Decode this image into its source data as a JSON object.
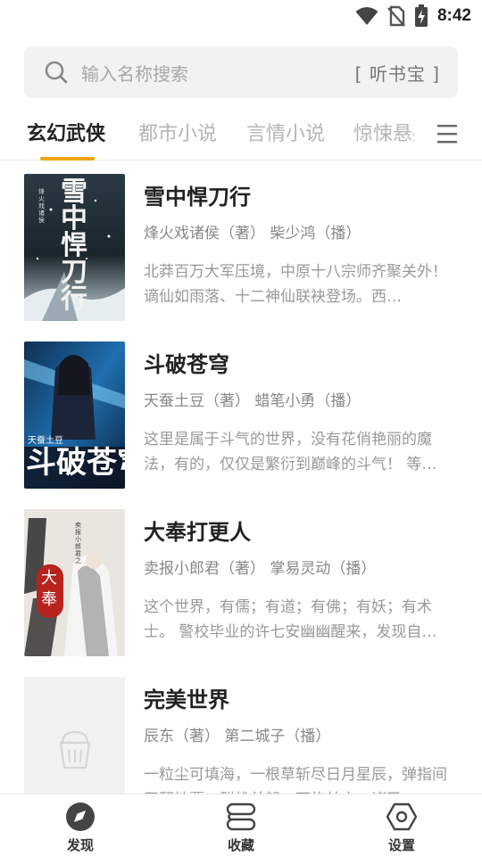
{
  "status_bar": {
    "time": "8:42",
    "icons": [
      "wifi-icon",
      "no-sim-icon",
      "battery-charging-icon"
    ]
  },
  "search": {
    "placeholder": "输入名称搜索",
    "source": "[ 听书宝 ]"
  },
  "tabs": [
    {
      "label": "玄幻武侠",
      "active": true
    },
    {
      "label": "都市小说",
      "active": false
    },
    {
      "label": "言情小说",
      "active": false
    },
    {
      "label": "惊悚悬疑",
      "active": false
    }
  ],
  "colors": {
    "accent": "#f0a500",
    "title": "#222222",
    "meta": "#888888",
    "description": "#999999",
    "inactive_tab": "#b5b5b5"
  },
  "books": [
    {
      "title": "雪中悍刀行",
      "meta": "烽火戏诸侯（著） 柴少鸿（播）",
      "description": "北莽百万大军压境，中原十八宗师齐聚关外！谪仙如雨落、十二神仙联袂登场。西…",
      "cover_text": "雪中悍刀行",
      "cover_author": "烽火戏诸侯"
    },
    {
      "title": "斗破苍穹",
      "meta": "天蚕土豆（著） 蜡笔小勇（播）",
      "description": "这里是属于斗气的世界，没有花俏艳丽的魔法，有的，仅仅是繁衍到巅峰的斗气！ 等…",
      "cover_text": "斗破苍穹",
      "cover_author": "天蚕土豆"
    },
    {
      "title": "大奉打更人",
      "meta": "卖报小郎君（著） 掌易灵动（播）",
      "description": "这个世界，有儒；有道；有佛；有妖；有术士。 警校毕业的许七安幽幽醒来，发现自…",
      "cover_text": "大奉",
      "cover_author": "卖报小郎君之"
    },
    {
      "title": "完美世界",
      "meta": "辰东（著） 第二城子（播）",
      "description": "一粒尘可填海，一根草斩尽日月星辰，弹指间天翻地覆。群雄并起，万族林立，诸圣…",
      "cover_text": "",
      "cover_author": ""
    }
  ],
  "bottom_nav": [
    {
      "label": "发现",
      "icon": "compass-icon",
      "active": true
    },
    {
      "label": "收藏",
      "icon": "stack-icon",
      "active": false
    },
    {
      "label": "设置",
      "icon": "hexagon-settings-icon",
      "active": false
    }
  ]
}
